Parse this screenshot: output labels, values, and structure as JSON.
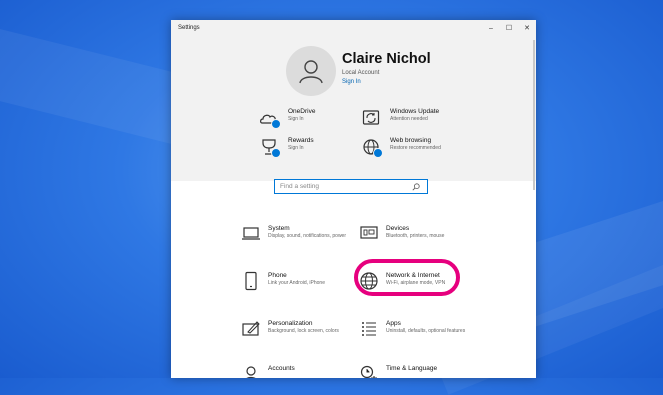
{
  "window": {
    "title": "Settings",
    "controls": {
      "minimize": "–",
      "maximize": "☐",
      "close": "✕"
    }
  },
  "account": {
    "name": "Claire Nichol",
    "type": "Local Account",
    "sign_in": "Sign In"
  },
  "quick_tiles": [
    {
      "icon": "onedrive-icon",
      "title": "OneDrive",
      "subtitle": "Sign In"
    },
    {
      "icon": "windows-update-icon",
      "title": "Windows Update",
      "subtitle": "Attention needed"
    },
    {
      "icon": "rewards-icon",
      "title": "Rewards",
      "subtitle": "Sign In"
    },
    {
      "icon": "web-browsing-icon",
      "title": "Web browsing",
      "subtitle": "Restore recommended"
    }
  ],
  "search": {
    "placeholder": "Find a setting",
    "icon": "search-icon"
  },
  "categories": [
    {
      "icon": "system-icon",
      "title": "System",
      "subtitle": "Display, sound, notifications, power"
    },
    {
      "icon": "devices-icon",
      "title": "Devices",
      "subtitle": "Bluetooth, printers, mouse"
    },
    {
      "icon": "phone-icon",
      "title": "Phone",
      "subtitle": "Link your Android, iPhone"
    },
    {
      "icon": "network-icon",
      "title": "Network & Internet",
      "subtitle": "Wi-Fi, airplane mode, VPN"
    },
    {
      "icon": "personalization-icon",
      "title": "Personalization",
      "subtitle": "Background, lock screen, colors"
    },
    {
      "icon": "apps-icon",
      "title": "Apps",
      "subtitle": "Uninstall, defaults, optional features"
    },
    {
      "icon": "accounts-icon",
      "title": "Accounts",
      "subtitle": ""
    },
    {
      "icon": "time-language-icon",
      "title": "Time & Language",
      "subtitle": ""
    }
  ],
  "colors": {
    "accent": "#0078d7",
    "highlight": "#e6007e",
    "desktop": "#2f78e4",
    "header_bg": "#f2f2f2"
  }
}
